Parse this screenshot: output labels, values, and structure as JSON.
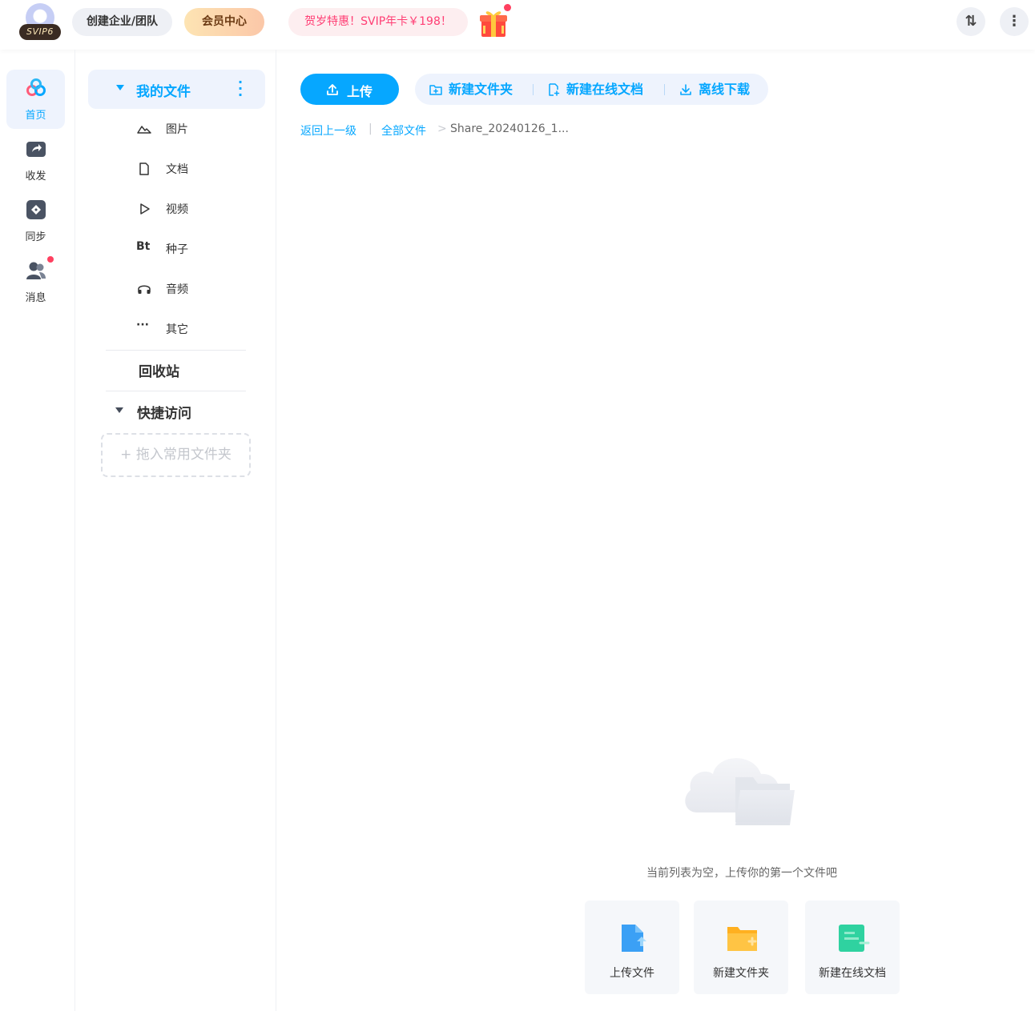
{
  "topbar": {
    "svip_badge": "SVIP6",
    "team_button": "创建企业/团队",
    "vip_center_button": "会员中心",
    "promo_text": "贺岁特惠！SVIP年卡￥198！",
    "gift_icon": "gift-icon",
    "transfer_icon": "transfer-icon",
    "transfer_glyph": "⇅",
    "more_icon": "more-vertical-icon",
    "more_glyph": "⋮"
  },
  "rail": {
    "items": [
      {
        "label": "首页",
        "icon": "home-cloud-icon",
        "active": true
      },
      {
        "label": "收发",
        "icon": "share-icon",
        "active": false
      },
      {
        "label": "同步",
        "icon": "sync-icon",
        "active": false
      },
      {
        "label": "消息",
        "icon": "message-icon",
        "active": false,
        "has_dot": true
      }
    ]
  },
  "tree": {
    "my_files": "我的文件",
    "more_glyph": "⋮",
    "categories": [
      {
        "label": "图片",
        "icon": "image-icon"
      },
      {
        "label": "文档",
        "icon": "document-icon"
      },
      {
        "label": "视频",
        "icon": "video-icon"
      },
      {
        "label": "种子",
        "icon": "torrent-icon",
        "glyph": "Bt"
      },
      {
        "label": "音频",
        "icon": "audio-icon"
      },
      {
        "label": "其它",
        "icon": "other-icon",
        "glyph": "···"
      }
    ],
    "recycle_bin": "回收站",
    "quick_access": "快捷访问",
    "drop_hint": "+ 拖入常用文件夹"
  },
  "toolbar": {
    "upload": "上传",
    "new_folder": "新建文件夹",
    "new_online_doc": "新建在线文档",
    "offline_download": "离线下载"
  },
  "breadcrumb": {
    "back": "返回上一级",
    "divider": "|",
    "all_files": "全部文件",
    "arrow": ">",
    "current": "Share_20240126_1..."
  },
  "empty_state": {
    "message": "当前列表为空，上传你的第一个文件吧",
    "cards": [
      {
        "label": "上传文件",
        "icon": "upload-file-icon"
      },
      {
        "label": "新建文件夹",
        "icon": "new-folder-icon"
      },
      {
        "label": "新建在线文档",
        "icon": "new-online-doc-icon"
      }
    ]
  },
  "colors": {
    "accent": "#06a7ff",
    "accent_bg": "#eef3fd",
    "promo": "#ff3e74"
  }
}
